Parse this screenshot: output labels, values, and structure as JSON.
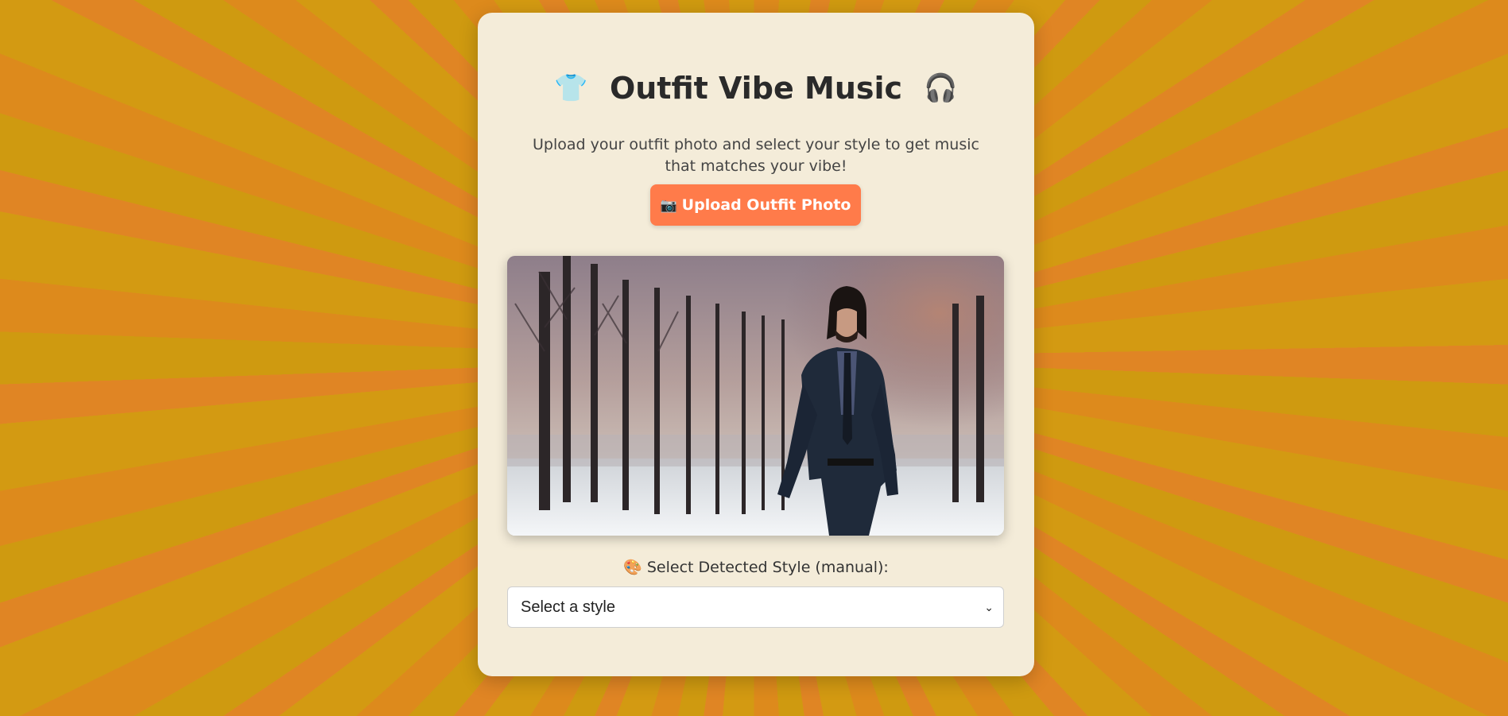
{
  "header": {
    "shirt_icon": "👕",
    "title": "Outfit Vibe Music",
    "headphone_icon": "🎧",
    "subtitle": "Upload your outfit photo and select your style to get music that matches your vibe!"
  },
  "upload": {
    "camera_icon": "📷",
    "label": "Upload Outfit Photo"
  },
  "preview": {
    "alt": "Uploaded outfit photo"
  },
  "style_picker": {
    "palette_icon": "🎨",
    "label": "Select Detected Style (manual):",
    "selected": "Select a style",
    "chevron_icon": "⌄"
  },
  "colors": {
    "accent": "#ff7b4a",
    "card": "#f4ecd9",
    "background_orange": "#dd8a1c",
    "background_yellow": "#d39a12"
  }
}
